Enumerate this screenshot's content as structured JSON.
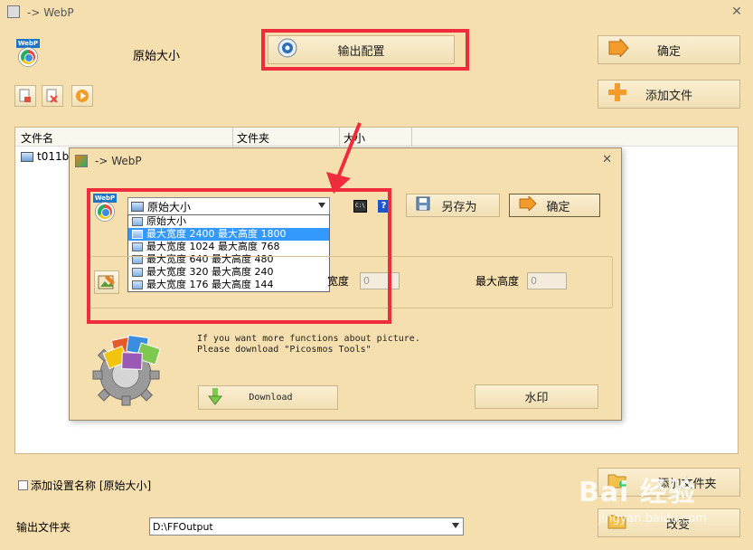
{
  "window": {
    "title": "-> WebP",
    "close_glyph": "✕"
  },
  "main": {
    "preset_label": "原始大小",
    "output_config_button": "输出配置",
    "ok_button": "确定",
    "add_file_button": "添加文件",
    "add_folder_button": "添加文件夹",
    "change_button": "改变",
    "list": {
      "columns": [
        "文件名",
        "文件夹",
        "大小"
      ],
      "rows": [
        {
          "name": "t011bc2"
        }
      ]
    },
    "add_setting_name_label": "添加设置名称 [原始大小]",
    "output_folder_label": "输出文件夹",
    "output_folder_value": "D:\\FFOutput"
  },
  "dialog": {
    "title": "-> WebP",
    "selected_preset": "原始大小",
    "save_as_button": "另存为",
    "ok_button": "确定",
    "help_glyph": "?",
    "options": [
      "原始大小",
      "最大宽度 2400 最大高度 1800",
      "最大宽度 1024 最大高度 768",
      "最大宽度 640 最大高度 480",
      "最大宽度 320 最大高度 240",
      "最大宽度 176 最大高度 144"
    ],
    "highlighted_option_index": 1,
    "max_width_label": "宽度",
    "max_width_value": "0",
    "max_height_label": "最大高度",
    "max_height_value": "0",
    "info_line1": "If you want more functions about picture.",
    "info_line2": "Please download \"Picosmos Tools\"",
    "download_button": "Download",
    "watermark_button": "水印"
  },
  "overlay": {
    "watermark_brand": "Bai 经验",
    "watermark_url": "jingyan.baidu.com"
  },
  "colors": {
    "background": "#f6dfae",
    "highlight_box": "#ee2c3b",
    "selection": "#3399ff"
  }
}
